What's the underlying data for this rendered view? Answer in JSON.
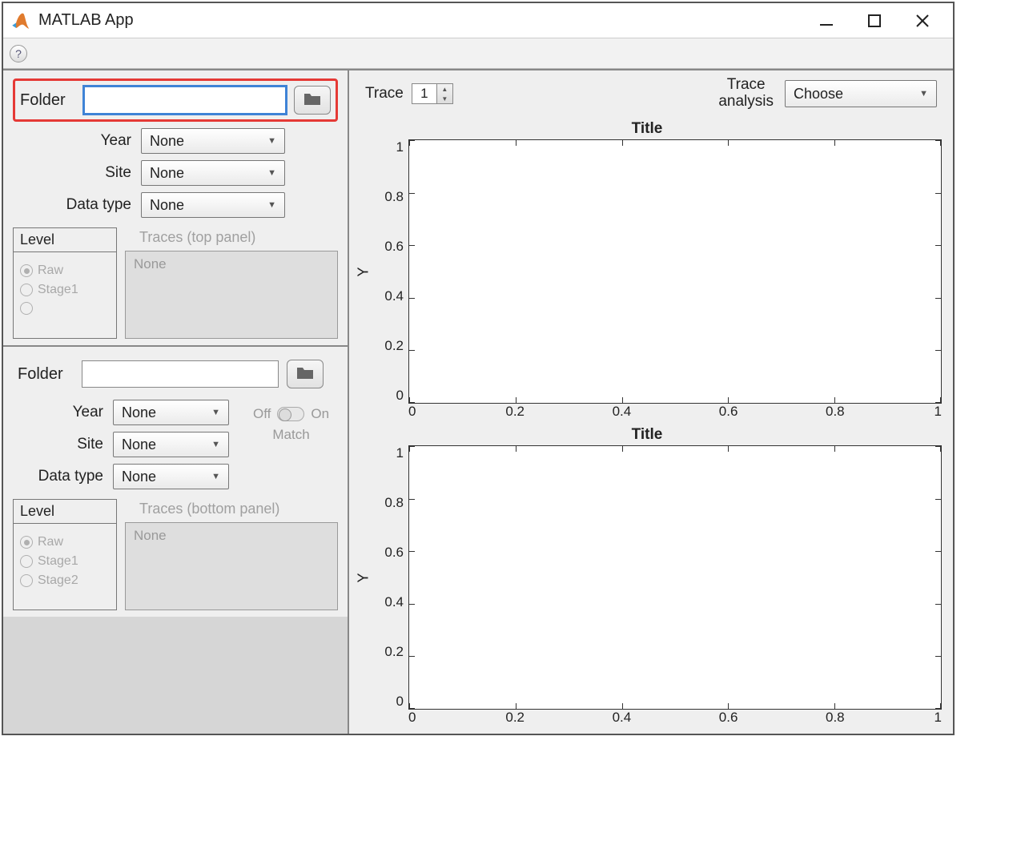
{
  "window": {
    "title": "MATLAB App"
  },
  "toolbar": {
    "help_tooltip": "?"
  },
  "panelA": {
    "folder_label": "Folder",
    "folder_value": "",
    "year_label": "Year",
    "year_value": "None",
    "site_label": "Site",
    "site_value": "None",
    "datatype_label": "Data type",
    "datatype_value": "None",
    "level_title": "Level",
    "level_options": [
      "Raw",
      "Stage1",
      ""
    ],
    "level_selected": "Raw",
    "traces_title": "Traces (top panel)",
    "traces_placeholder": "None"
  },
  "panelB": {
    "folder_label": "Folder",
    "folder_value": "",
    "year_label": "Year",
    "year_value": "None",
    "site_label": "Site",
    "site_value": "None",
    "datatype_label": "Data type",
    "datatype_value": "None",
    "toggle_off": "Off",
    "toggle_on": "On",
    "toggle_match": "Match",
    "level_title": "Level",
    "level_options": [
      "Raw",
      "Stage1",
      "Stage2"
    ],
    "level_selected": "Raw",
    "traces_title": "Traces (bottom  panel)",
    "traces_placeholder": "None"
  },
  "right": {
    "trace_label": "Trace",
    "trace_value": "1",
    "trace_analysis_label": "Trace\nanalysis",
    "trace_analysis_value": "Choose"
  },
  "chart_data": [
    {
      "type": "line",
      "title": "Title",
      "xlabel": "",
      "ylabel": "Y",
      "xlim": [
        0,
        1
      ],
      "ylim": [
        0,
        1
      ],
      "xticks": [
        0,
        0.2,
        0.4,
        0.6,
        0.8,
        1
      ],
      "yticks": [
        0,
        0.2,
        0.4,
        0.6,
        0.8,
        1
      ],
      "series": []
    },
    {
      "type": "line",
      "title": "Title",
      "xlabel": "",
      "ylabel": "Y",
      "xlim": [
        0,
        1
      ],
      "ylim": [
        0,
        1
      ],
      "xticks": [
        0,
        0.2,
        0.4,
        0.6,
        0.8,
        1
      ],
      "yticks": [
        0,
        0.2,
        0.4,
        0.6,
        0.8,
        1
      ],
      "series": []
    }
  ]
}
